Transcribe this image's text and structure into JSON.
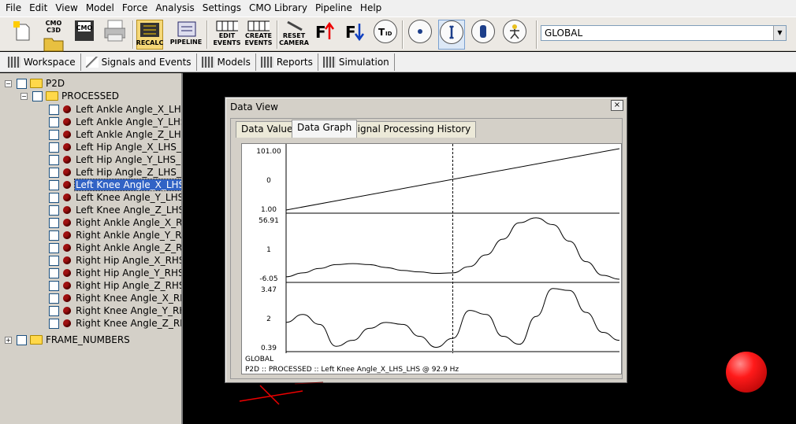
{
  "menu": [
    "File",
    "Edit",
    "View",
    "Model",
    "Force",
    "Analysis",
    "Settings",
    "CMO Library",
    "Pipeline",
    "Help"
  ],
  "toolbar": {
    "cmo_c3d": "CMO C3D",
    "cmo": "CMO",
    "recalc": "RECALC",
    "pipeline": "PIPELINE",
    "edit_events": [
      "EDIT",
      "EVENTS"
    ],
    "create_events": [
      "CREATE",
      "EVENTS"
    ],
    "reset_camera": [
      "RESET",
      "CAMERA"
    ],
    "view_select": "GLOBAL"
  },
  "workspace_tabs": [
    "Workspace",
    "Signals and Events",
    "Models",
    "Reports",
    "Simulation"
  ],
  "tree": {
    "root": "P2D",
    "processed": "PROCESSED",
    "signals": [
      "Left Ankle Angle_X_LHS_L",
      "Left Ankle Angle_Y_LHS_L",
      "Left Ankle Angle_Z_LHS_L",
      "Left Hip Angle_X_LHS_LHS",
      "Left Hip Angle_Y_LHS_LHS",
      "Left Hip Angle_Z_LHS_LHS",
      "Left Knee Angle_X_LHS_L",
      "Left Knee Angle_Y_LHS_L",
      "Left Knee Angle_Z_LHS_L",
      "Right Ankle Angle_X_RHS_",
      "Right Ankle Angle_Y_RHS_",
      "Right Ankle Angle_Z_RHS_",
      "Right Hip Angle_X_RHS_R",
      "Right Hip Angle_Y_RHS_R",
      "Right Hip Angle_Z_RHS_R",
      "Right Knee Angle_X_RHS_",
      "Right Knee Angle_Y_RHS_",
      "Right Knee Angle_Z_RHS_"
    ],
    "selected_index": 6,
    "frame_numbers": "FRAME_NUMBERS"
  },
  "data_view": {
    "title": "Data View",
    "close": "×",
    "tabs": [
      "Data Values",
      "Data Graph",
      "Signal Processing History"
    ],
    "active_tab": "Data Graph",
    "reference_frame": "GLOBAL",
    "footer": "P2D :: PROCESSED  :: Left Knee Angle_X_LHS_LHS @ 92.9 Hz"
  },
  "chart_data": {
    "type": "line",
    "cursor_x": 0.5,
    "panels": [
      {
        "ytop": "101.00",
        "ymid": "0",
        "ybot": "1.00",
        "ylim": [
          1.0,
          101.0
        ],
        "x": [
          0,
          0.1,
          0.2,
          0.3,
          0.4,
          0.5,
          0.6,
          0.7,
          0.8,
          0.9,
          1.0
        ],
        "y": [
          1,
          11,
          21,
          31,
          41,
          51,
          61,
          71,
          81,
          91,
          101
        ]
      },
      {
        "ytop": "56.91",
        "ymid": "1",
        "ybot": "-6.05",
        "ylim": [
          -6.05,
          56.91
        ],
        "x": [
          0,
          0.05,
          0.1,
          0.15,
          0.2,
          0.25,
          0.3,
          0.35,
          0.4,
          0.45,
          0.5,
          0.55,
          0.6,
          0.65,
          0.7,
          0.75,
          0.8,
          0.85,
          0.9,
          0.95,
          1.0
        ],
        "y": [
          -3.5,
          0.5,
          5,
          9,
          10,
          9,
          6,
          3,
          1.5,
          0,
          0.5,
          7,
          19,
          35,
          52,
          57,
          50,
          33,
          12,
          -2,
          -6
        ]
      },
      {
        "ytop": "3.47",
        "ymid": "2",
        "ybot": "0.39",
        "ylim": [
          0.39,
          3.47
        ],
        "x": [
          0,
          0.05,
          0.1,
          0.15,
          0.2,
          0.25,
          0.3,
          0.35,
          0.4,
          0.45,
          0.5,
          0.55,
          0.6,
          0.65,
          0.7,
          0.75,
          0.8,
          0.85,
          0.9,
          0.95,
          1.0
        ],
        "y": [
          1.7,
          2.1,
          1.6,
          0.5,
          0.8,
          1.4,
          1.7,
          1.6,
          1.0,
          0.45,
          0.9,
          2.3,
          2.1,
          1.0,
          0.6,
          2.0,
          3.4,
          3.3,
          2.2,
          1.2,
          0.8
        ]
      }
    ]
  }
}
